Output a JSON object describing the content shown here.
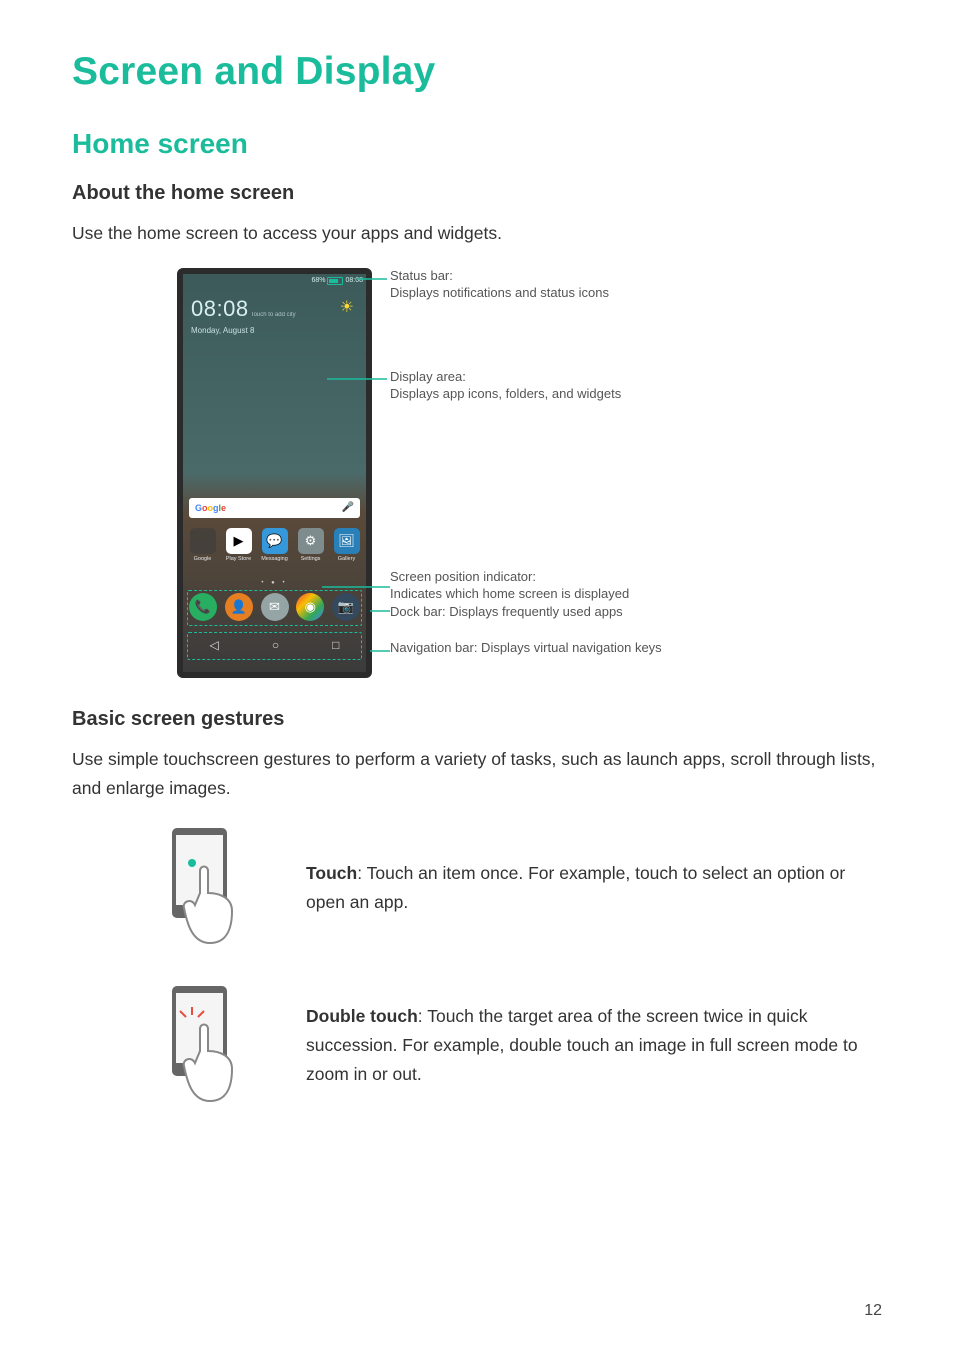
{
  "page_number": "12",
  "title": "Screen and Display",
  "section": "Home screen",
  "sub1": {
    "heading": "About the home screen",
    "intro": "Use the home screen to access your apps and widgets."
  },
  "phone": {
    "status": {
      "pct": "68%",
      "time": "08:08"
    },
    "widget": {
      "time": "08:08",
      "addcity": "Touch to add city",
      "date": "Monday, August 8"
    },
    "search": {
      "label": "Google"
    },
    "apps": [
      {
        "name": "Google"
      },
      {
        "name": "Play Store"
      },
      {
        "name": "Messaging"
      },
      {
        "name": "Settings"
      },
      {
        "name": "Gallery"
      }
    ],
    "dots": "•  ●  •"
  },
  "callouts": {
    "status_t": "Status bar:",
    "status_d": "Displays notifications and status icons",
    "display_t": "Display area:",
    "display_d": "Displays app icons, folders, and widgets",
    "pos_t": "Screen position indicator:",
    "pos_d": "Indicates which home screen is displayed",
    "dock": "Dock bar: Displays frequently used apps",
    "nav": "Navigation bar: Displays virtual navigation keys"
  },
  "sub2": {
    "heading": "Basic screen gestures",
    "intro": "Use simple touchscreen gestures to perform a variety of tasks, such as launch apps, scroll through lists, and enlarge images."
  },
  "gestures": [
    {
      "name": "Touch",
      "desc": ": Touch an item once. For example, touch to select an option or open an app."
    },
    {
      "name": "Double touch",
      "desc": ": Touch the target area of the screen twice in quick succession. For example, double touch an image in full screen mode to zoom in or out."
    }
  ]
}
